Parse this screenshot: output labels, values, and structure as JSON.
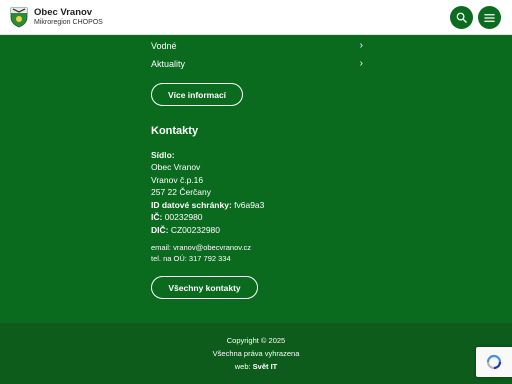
{
  "header": {
    "title": "Obec Vranov",
    "subtitle": "Mikroregion CHOPOS",
    "logo_icon": "village-coat-of-arms-icon",
    "search_icon": "search-icon",
    "menu_icon": "hamburger-menu-icon"
  },
  "nav": {
    "items": [
      {
        "label": "Vodné",
        "icon": "chevron-right-icon"
      },
      {
        "label": "Aktuality",
        "icon": "chevron-right-icon"
      }
    ],
    "more_button": "Více informací"
  },
  "contacts": {
    "title": "Kontakty",
    "seat_label": "Sídlo:",
    "name": "Obec Vranov",
    "street": "Vranov č.p.16",
    "city": "257 22 Čerčany",
    "databox_label": "ID datové schránky:",
    "databox_value": " fv6a9a3",
    "ic_label": "IČ:",
    "ic_value": " 00232980",
    "dic_label": "DIČ:",
    "dic_value": " CZ00232980",
    "email": "email: vranov@obecvranov.cz",
    "phone": "tel. na OÚ: 317 792 334",
    "all_contacts_button": "Všechny kontakty"
  },
  "footer": {
    "copyright": "Copyright © 2025",
    "rights": "Všechna práva vyhrazena",
    "web_label": "web: ",
    "web_value": "Svět IT"
  },
  "colors": {
    "primary_green": "#0a6a1e",
    "footer_green": "#0d5c1c",
    "header_bg": "#ffffff"
  }
}
